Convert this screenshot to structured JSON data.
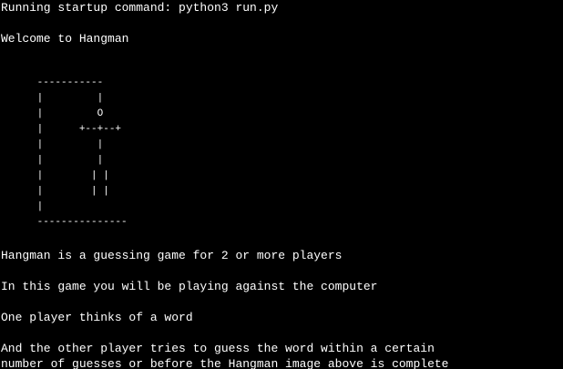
{
  "terminal": {
    "startup_command": "Running startup command: python3 run.py",
    "welcome": "Welcome to Hangman",
    "hangman_art": [
      "      -----------",
      "      |         |",
      "      |         O",
      "      |      +--+--+",
      "      |         |",
      "      |         |",
      "      |        | |",
      "      |        | |",
      "      |",
      "      ---------------"
    ],
    "intro_lines": [
      "Hangman is a guessing game for 2 or more players",
      "In this game you will be playing against the computer",
      "One player thinks of a word",
      "And the other player tries to guess the word within a certain",
      "number of guesses or before the Hangman image above is complete"
    ],
    "colors": {
      "background": "#000000",
      "text": "#ffffff"
    }
  }
}
